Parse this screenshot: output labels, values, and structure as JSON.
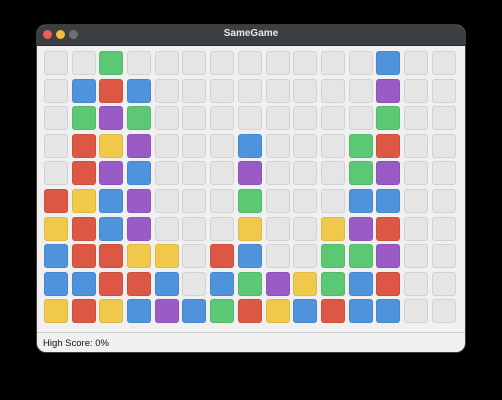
{
  "window": {
    "title": "SameGame"
  },
  "status": {
    "high_score_text": "High Score: 0%"
  },
  "colors": {
    "green": "#5dc873",
    "blue": "#4e93dc",
    "red": "#dc5845",
    "purple": "#9b5bc7",
    "yellow": "#f1c94a",
    "empty": "#e5e5e5"
  },
  "board": {
    "rows": [
      [
        "empty",
        "empty",
        "green",
        "empty",
        "empty",
        "empty",
        "empty",
        "empty",
        "empty",
        "empty",
        "empty",
        "empty",
        "blue",
        "empty",
        "empty"
      ],
      [
        "empty",
        "blue",
        "red",
        "blue",
        "empty",
        "empty",
        "empty",
        "empty",
        "empty",
        "empty",
        "empty",
        "empty",
        "purple",
        "empty",
        "empty"
      ],
      [
        "empty",
        "green",
        "purple",
        "green",
        "empty",
        "empty",
        "empty",
        "empty",
        "empty",
        "empty",
        "empty",
        "empty",
        "green",
        "empty",
        "empty"
      ],
      [
        "empty",
        "red",
        "yellow",
        "purple",
        "empty",
        "empty",
        "empty",
        "blue",
        "empty",
        "empty",
        "empty",
        "green",
        "red",
        "empty",
        "empty"
      ],
      [
        "empty",
        "red",
        "purple",
        "blue",
        "empty",
        "empty",
        "empty",
        "purple",
        "empty",
        "empty",
        "empty",
        "green",
        "purple",
        "empty",
        "empty"
      ],
      [
        "red",
        "yellow",
        "blue",
        "purple",
        "empty",
        "empty",
        "empty",
        "green",
        "empty",
        "empty",
        "empty",
        "blue",
        "blue",
        "empty",
        "empty"
      ],
      [
        "yellow",
        "red",
        "blue",
        "purple",
        "empty",
        "empty",
        "empty",
        "yellow",
        "empty",
        "empty",
        "yellow",
        "purple",
        "red",
        "empty",
        "empty"
      ],
      [
        "blue",
        "red",
        "red",
        "yellow",
        "yellow",
        "empty",
        "red",
        "blue",
        "empty",
        "empty",
        "green",
        "green",
        "purple",
        "empty",
        "empty"
      ],
      [
        "blue",
        "blue",
        "red",
        "red",
        "blue",
        "empty",
        "blue",
        "green",
        "purple",
        "yellow",
        "green",
        "blue",
        "red",
        "empty",
        "empty"
      ],
      [
        "yellow",
        "red",
        "yellow",
        "blue",
        "purple",
        "blue",
        "green",
        "red",
        "yellow",
        "blue",
        "red",
        "blue",
        "blue",
        "empty",
        "empty"
      ]
    ]
  }
}
